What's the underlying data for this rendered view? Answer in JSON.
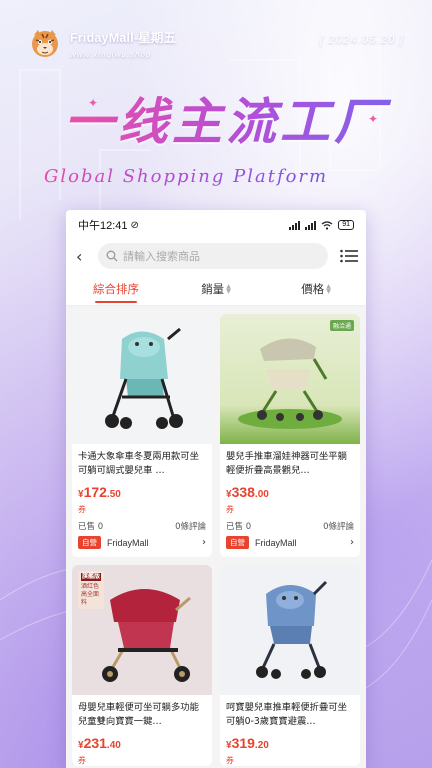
{
  "brand": {
    "name": "FridayMall-星期五",
    "url": "www.xinqiwu.shop",
    "date": "[ 2024.05.20 ]"
  },
  "headline": "一线主流工厂",
  "subheadline": "Global Shopping Platform",
  "colors": {
    "accent": "#e8432e",
    "headline_start": "#ef4fa2",
    "headline_end": "#7d63ee"
  },
  "phone": {
    "status": {
      "time": "中午12:41",
      "battery": "91"
    },
    "search": {
      "placeholder": "請輸入搜索商品"
    },
    "sort": {
      "tabs": [
        "綜合排序",
        "銷量",
        "價格"
      ]
    },
    "products": [
      {
        "title": "卡通大象傘車冬夏兩用款可坐可躺可調式嬰兒車 …",
        "price_currency": "¥",
        "price_int": "172",
        "price_dec": ".50",
        "coupon": "券",
        "sold": "已售 0",
        "reviews": "0條評論",
        "badge": "自營",
        "shop": "FridayMall"
      },
      {
        "title": "嬰兒手推車溜娃神器可坐平躺輕便折疊高景觀兒…",
        "price_currency": "¥",
        "price_int": "338",
        "price_dec": ".00",
        "coupon": "券",
        "sold": "已售 0",
        "reviews": "0條評論",
        "badge": "自營",
        "shop": "FridayMall",
        "image_tag": "融洽通"
      },
      {
        "title": "母嬰兒車輕便可坐可躺多功能兒童雙向寶寶一鍵…",
        "price_currency": "¥",
        "price_int": "231",
        "price_dec": ".40",
        "coupon": "券",
        "sold": "",
        "reviews": "",
        "badge": "",
        "shop": "",
        "image_tag": "旗艦版",
        "image_tag_sub": "酒红色 高全面料"
      },
      {
        "title": "呵寶嬰兒車推車輕便折疊可坐可躺0-3歲寶寶避震…",
        "price_currency": "¥",
        "price_int": "319",
        "price_dec": ".20",
        "coupon": "券",
        "sold": "",
        "reviews": "",
        "badge": "",
        "shop": ""
      }
    ]
  }
}
